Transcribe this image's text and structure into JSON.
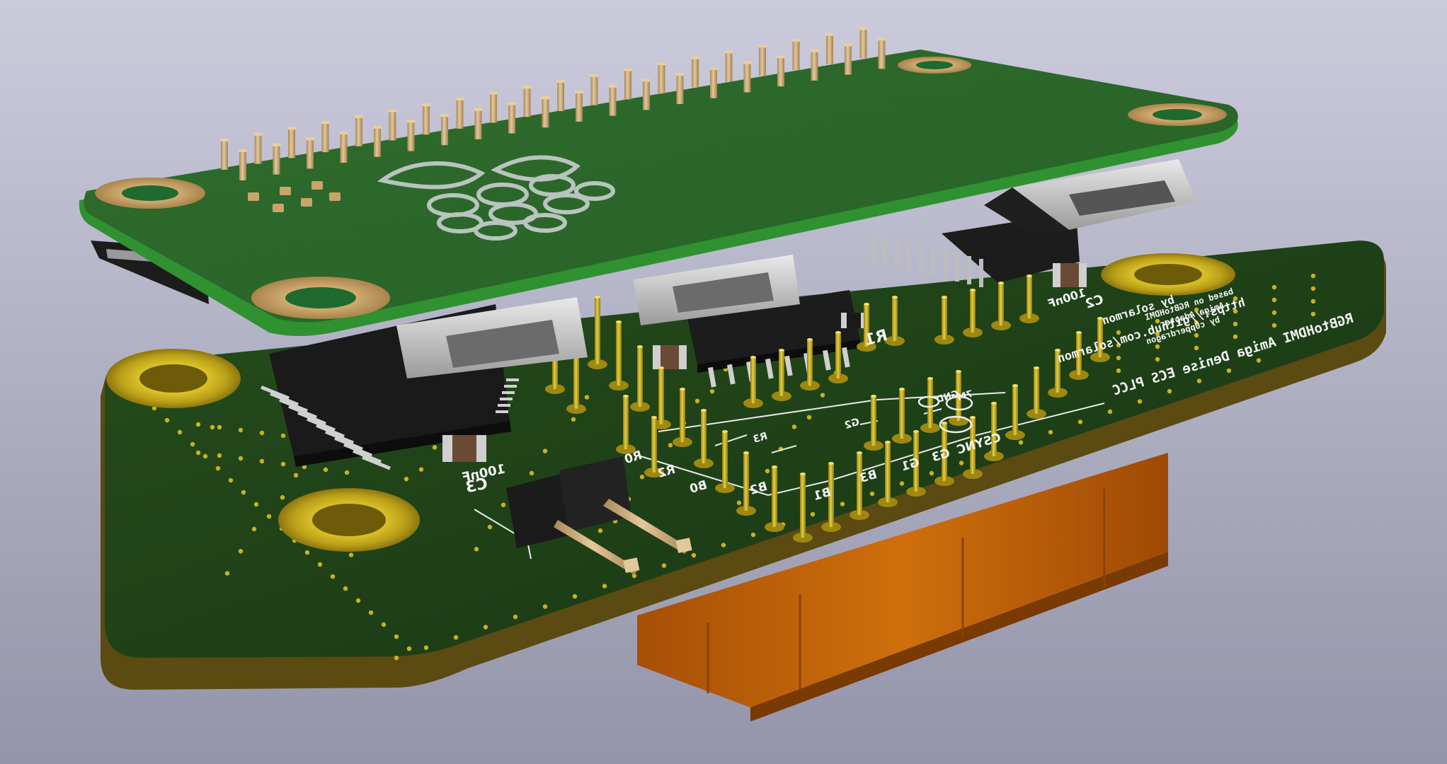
{
  "scene": {
    "background_top": "#c9c9da",
    "background_bottom": "#8f8fa6",
    "lower_pcb_color": "#1e3d16",
    "lower_pcb_edge": "#5a4a10",
    "upper_pcb_color": "#2f6e2c",
    "upper_pcb_edge": "#3aa63a",
    "gold": "#b9a21b",
    "copper_pad": "#c4a066",
    "connector_orange": "#c6670a"
  },
  "upper_board": {
    "logo": "raspberry-logo"
  },
  "lower_board": {
    "silkscreen_title": "RGBtoHDMI Amiga Denise ECS PLCC",
    "silkscreen_url": "https://github.com/solarmon",
    "silkscreen_by": "by solarmon",
    "silkscreen_based_1": "based on RGBtoHDMI",
    "silkscreen_based_2": "Amiga Adapter",
    "silkscreen_based_3": "by c0pperdragon",
    "refs": {
      "r1": "R1",
      "c2": "C2",
      "c2_val": "100nF",
      "c3": "C3",
      "c3_val": "100nF"
    },
    "pins": {
      "r0": "R0",
      "r2": "R2",
      "r3": "R3",
      "b0": "B0",
      "b2": "B2",
      "b1": "B1",
      "b3": "B3",
      "g1": "G1",
      "g2": "G2",
      "g3": "G3",
      "csync": "CSYNC",
      "gnd": "GND",
      "7m": "7M"
    }
  }
}
